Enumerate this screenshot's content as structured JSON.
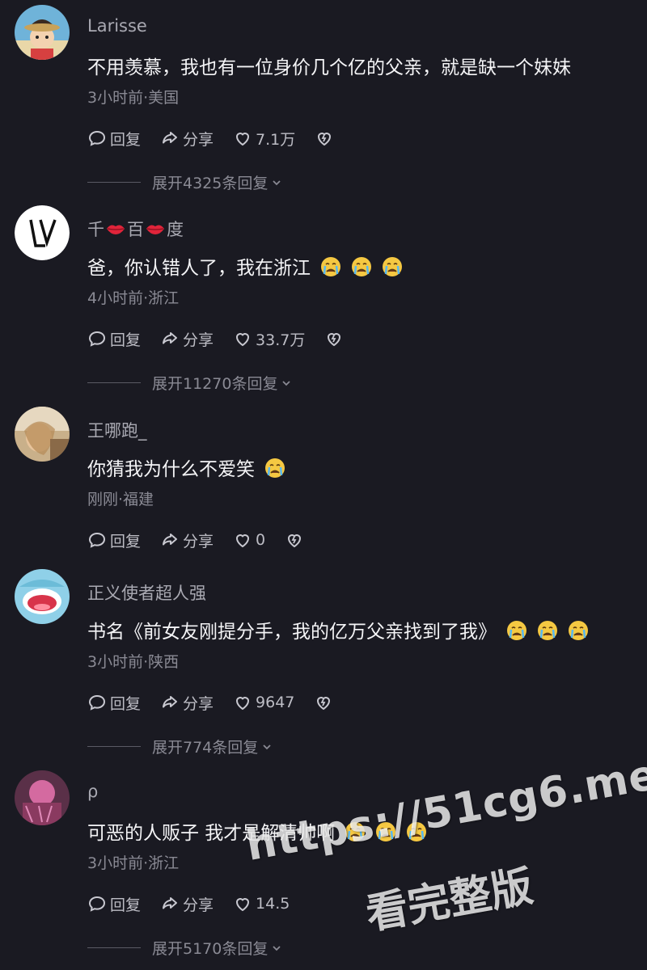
{
  "labels": {
    "reply": "回复",
    "share": "分享"
  },
  "comments": [
    {
      "username": "Larisse",
      "text": "不用羡慕，我也有一位身价几个亿的父亲，就是缺一个妹妹",
      "meta": "3小时前·美国",
      "likes": "7.1万",
      "expand": "展开4325条回复",
      "avatar_icon": "cartoon-boy-avatar"
    },
    {
      "username_parts": [
        "千",
        "百",
        "度"
      ],
      "text": "爸，你认错人了，我在浙江",
      "meta": "4小时前·浙江",
      "likes": "33.7万",
      "expand": "展开11270条回复",
      "avatar_icon": "lv-logo-avatar"
    },
    {
      "username": "王哪跑_",
      "text": "你猜我为什么不爱笑",
      "meta": "刚刚·福建",
      "likes": "0",
      "avatar_icon": "photo-avatar"
    },
    {
      "username": "正义使者超人强",
      "text": "书名《前女友刚提分手，我的亿万父亲找到了我》",
      "meta": "3小时前·陕西",
      "likes": "9647",
      "expand": "展开774条回复",
      "avatar_icon": "cartoon-mouth-avatar"
    },
    {
      "username": "ρ",
      "text": "可恶的人贩子 我才是解清帅啊",
      "meta": "3小时前·浙江",
      "likes": "14.5",
      "expand": "展开5170条回复",
      "avatar_icon": "pink-photo-avatar"
    }
  ],
  "watermark": {
    "line1": "https://51cg6.me",
    "line2": "看完整版"
  },
  "colors": {
    "background": "#1a1a22",
    "primary_text": "#f4f4f6",
    "secondary_text": "#8a8a94",
    "action_text": "#bdbdc5",
    "lip_red": "#e0243a",
    "emoji_yellow": "#f5c842"
  }
}
